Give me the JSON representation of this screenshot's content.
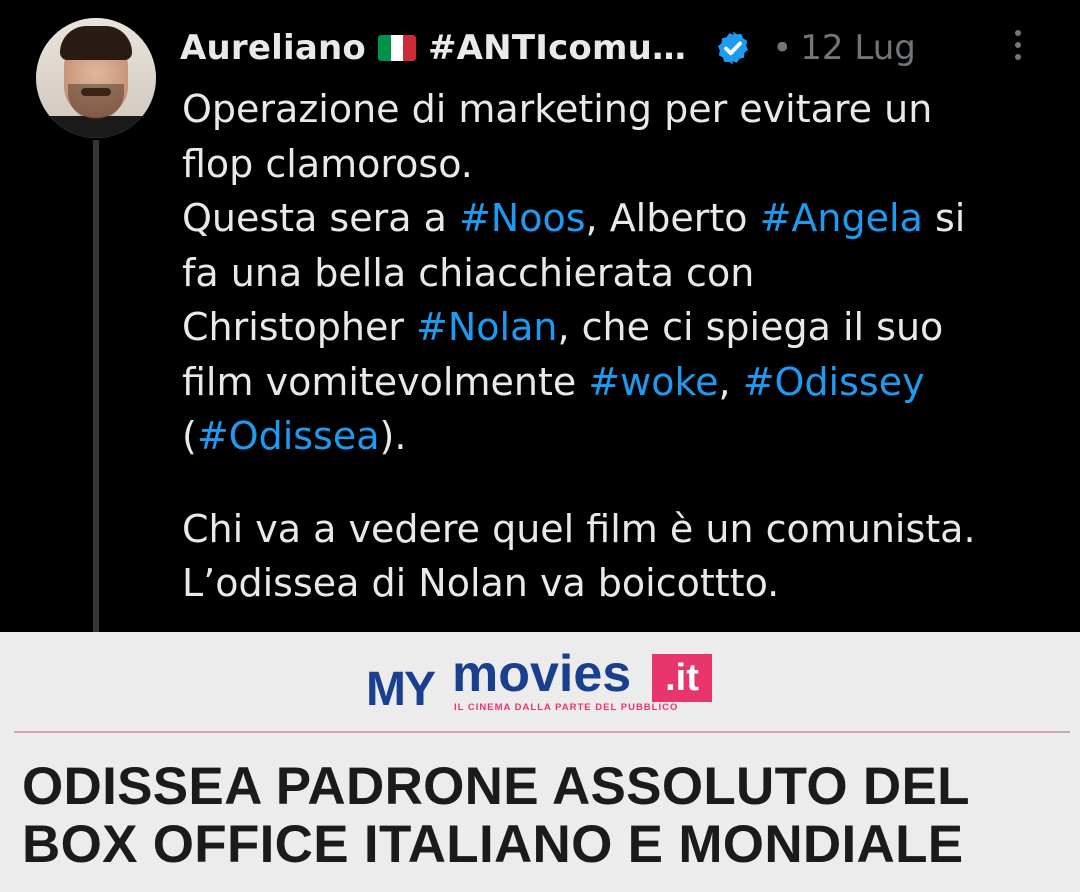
{
  "tweet": {
    "author_name": "Aureliano",
    "author_handle_fragment": "#ANTIcomu…",
    "flag_colors": [
      "#009246",
      "#ffffff",
      "#ce2b37"
    ],
    "verified_color": "#1d9bf0",
    "separator": "•",
    "date": "12 Lug",
    "hashtag_color": "#1d9bf0",
    "text": {
      "l1": "Operazione di marketing per evitare un",
      "l2": "flop clamoroso.",
      "l3a": "Questa sera a ",
      "l3b": "#Noos",
      "l3c": ", Alberto ",
      "l3d": "#Angela",
      "l3e": " si",
      "l4": "fa una bella chiacchierata con",
      "l5a": "Christopher ",
      "l5b": "#Nolan",
      "l5c": ", che ci spiega il suo",
      "l6a": "film vomitevolmente ",
      "l6b": "#woke",
      "l6c": ", ",
      "l6d": "#Odissey",
      "l7a": "(",
      "l7b": "#Odissea",
      "l7c": ").",
      "l8": "Chi va a vedere quel film è un comunista.",
      "l9": "L’odissea di Nolan va boicottto."
    }
  },
  "banner": {
    "logo_my": "MY",
    "logo_movies": "movies",
    "logo_it": ".it",
    "logo_tagline": "IL CINEMA DALLA PARTE DEL PUBBLICO",
    "headline_line1": "ODISSEA PADRONE ASSOLUTO DEL",
    "headline_line2": "BOX OFFICE ITALIANO E MONDIALE",
    "brand_blue": "#1a3f8f",
    "brand_pink": "#e8366d"
  },
  "icons": [
    "avatar",
    "italy-flag-icon",
    "verified-badge-icon",
    "more-options-icon"
  ]
}
